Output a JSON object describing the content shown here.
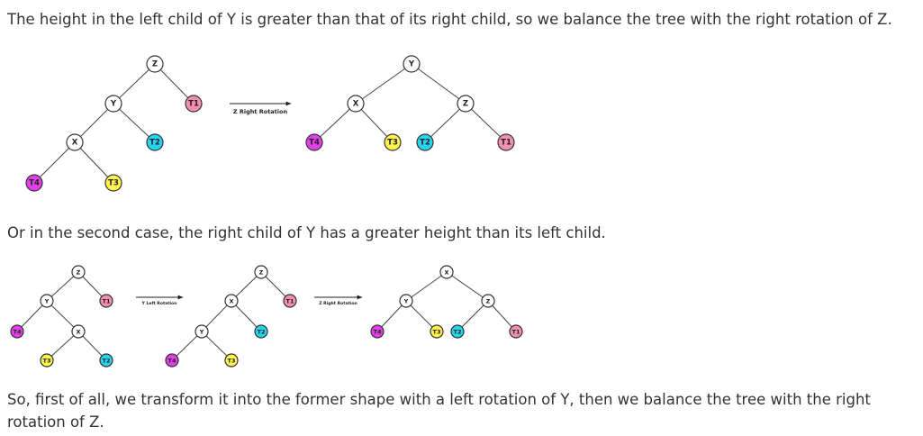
{
  "text": {
    "intro": "The height in the left child of Y is greater than that of its right child, so we balance the tree with the right rotation of Z.",
    "second_case": "Or in the second case, the right child of Y has a greater height than its left child.",
    "conclusion": "So, first of all, we transform it into the former shape with a left rotation of Y, then we balance the tree with the right rotation of Z."
  },
  "colors": {
    "white": "#ffffff",
    "pink": "#f48fb1",
    "cyan": "#26d4f0",
    "yellow": "#fff44f",
    "magenta": "#e040e8"
  },
  "diagrams": [
    {
      "id": "d1",
      "arrows": [
        {
          "caption": "Z Right Rotation"
        }
      ],
      "trees": [
        {
          "nodes": [
            {
              "id": "Z",
              "label": "Z",
              "color": "white"
            },
            {
              "id": "Y",
              "label": "Y",
              "color": "white"
            },
            {
              "id": "T1",
              "label": "T1",
              "color": "pink"
            },
            {
              "id": "X",
              "label": "X",
              "color": "white"
            },
            {
              "id": "T2",
              "label": "T2",
              "color": "cyan"
            },
            {
              "id": "T4",
              "label": "T4",
              "color": "magenta"
            },
            {
              "id": "T3",
              "label": "T3",
              "color": "yellow"
            }
          ],
          "edges": [
            [
              "Z",
              "Y"
            ],
            [
              "Z",
              "T1"
            ],
            [
              "Y",
              "X"
            ],
            [
              "Y",
              "T2"
            ],
            [
              "X",
              "T4"
            ],
            [
              "X",
              "T3"
            ]
          ]
        },
        {
          "nodes": [
            {
              "id": "Y",
              "label": "Y",
              "color": "white"
            },
            {
              "id": "X",
              "label": "X",
              "color": "white"
            },
            {
              "id": "Z",
              "label": "Z",
              "color": "white"
            },
            {
              "id": "T4",
              "label": "T4",
              "color": "magenta"
            },
            {
              "id": "T3",
              "label": "T3",
              "color": "yellow"
            },
            {
              "id": "T2",
              "label": "T2",
              "color": "cyan"
            },
            {
              "id": "T1",
              "label": "T1",
              "color": "pink"
            }
          ],
          "edges": [
            [
              "Y",
              "X"
            ],
            [
              "Y",
              "Z"
            ],
            [
              "X",
              "T4"
            ],
            [
              "X",
              "T3"
            ],
            [
              "Z",
              "T2"
            ],
            [
              "Z",
              "T1"
            ]
          ]
        }
      ]
    },
    {
      "id": "d2",
      "arrows": [
        {
          "caption": "Y Left Rotation"
        },
        {
          "caption": "Z Right Rotation"
        }
      ],
      "trees": [
        {
          "nodes": [
            {
              "id": "Z",
              "label": "Z",
              "color": "white"
            },
            {
              "id": "Y",
              "label": "Y",
              "color": "white"
            },
            {
              "id": "T1",
              "label": "T1",
              "color": "pink"
            },
            {
              "id": "T4",
              "label": "T4",
              "color": "magenta"
            },
            {
              "id": "X",
              "label": "X",
              "color": "white"
            },
            {
              "id": "T3",
              "label": "T3",
              "color": "yellow"
            },
            {
              "id": "T2",
              "label": "T2",
              "color": "cyan"
            }
          ],
          "edges": [
            [
              "Z",
              "Y"
            ],
            [
              "Z",
              "T1"
            ],
            [
              "Y",
              "T4"
            ],
            [
              "Y",
              "X"
            ],
            [
              "X",
              "T3"
            ],
            [
              "X",
              "T2"
            ]
          ]
        },
        {
          "nodes": [
            {
              "id": "Z",
              "label": "Z",
              "color": "white"
            },
            {
              "id": "X",
              "label": "X",
              "color": "white"
            },
            {
              "id": "T1",
              "label": "T1",
              "color": "pink"
            },
            {
              "id": "Y",
              "label": "Y",
              "color": "white"
            },
            {
              "id": "T2",
              "label": "T2",
              "color": "cyan"
            },
            {
              "id": "T4",
              "label": "T4",
              "color": "magenta"
            },
            {
              "id": "T3",
              "label": "T3",
              "color": "yellow"
            }
          ],
          "edges": [
            [
              "Z",
              "X"
            ],
            [
              "Z",
              "T1"
            ],
            [
              "X",
              "Y"
            ],
            [
              "X",
              "T2"
            ],
            [
              "Y",
              "T4"
            ],
            [
              "Y",
              "T3"
            ]
          ]
        },
        {
          "nodes": [
            {
              "id": "X",
              "label": "X",
              "color": "white"
            },
            {
              "id": "Y",
              "label": "Y",
              "color": "white"
            },
            {
              "id": "Z",
              "label": "Z",
              "color": "white"
            },
            {
              "id": "T4",
              "label": "T4",
              "color": "magenta"
            },
            {
              "id": "T3",
              "label": "T3",
              "color": "yellow"
            },
            {
              "id": "T2",
              "label": "T2",
              "color": "cyan"
            },
            {
              "id": "T1",
              "label": "T1",
              "color": "pink"
            }
          ],
          "edges": [
            [
              "X",
              "Y"
            ],
            [
              "X",
              "Z"
            ],
            [
              "Y",
              "T4"
            ],
            [
              "Y",
              "T3"
            ],
            [
              "Z",
              "T2"
            ],
            [
              "Z",
              "T1"
            ]
          ]
        }
      ]
    }
  ]
}
